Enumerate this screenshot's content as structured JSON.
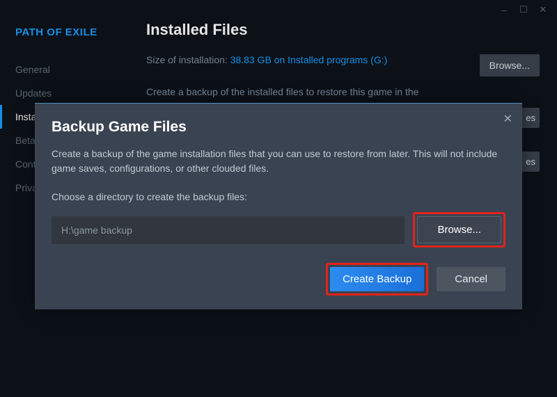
{
  "window": {
    "minimize": "–",
    "maximize": "☐",
    "close": "✕"
  },
  "sidebar": {
    "title": "PATH OF EXILE",
    "items": [
      {
        "label": "General"
      },
      {
        "label": "Updates"
      },
      {
        "label": "Installed Files",
        "active": true
      },
      {
        "label": "Betas"
      },
      {
        "label": "Controller"
      },
      {
        "label": "Privacy"
      }
    ]
  },
  "content": {
    "title": "Installed Files",
    "size_label": "Size of installation: ",
    "size_value": "38.83 GB on Installed programs (G:)",
    "browse_label": "Browse...",
    "desc_truncated": "Create a backup of the installed files to restore this game in the",
    "bg_btn_suffix": "es"
  },
  "modal": {
    "title": "Backup Game Files",
    "description": "Create a backup of the game installation files that you can use to restore from later. This will not include game saves, configurations, or other clouded files.",
    "choose_label": "Choose a directory to create the backup files:",
    "path_value": "H:\\game backup",
    "browse_label": "Browse...",
    "create_label": "Create Backup",
    "cancel_label": "Cancel",
    "close_glyph": "✕"
  }
}
